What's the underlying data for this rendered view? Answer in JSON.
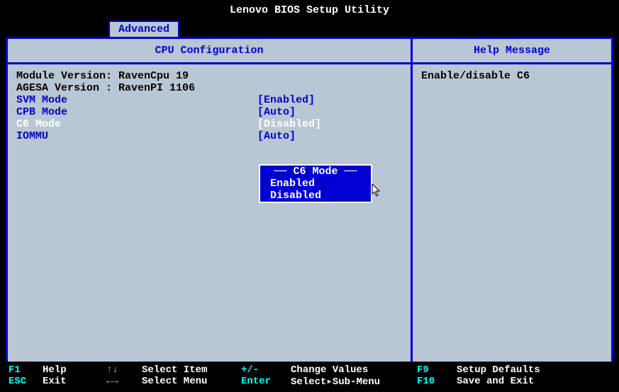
{
  "title": "Lenovo BIOS Setup Utility",
  "tab": "Advanced",
  "left": {
    "title": "CPU Configuration",
    "info1": "Module Version: RavenCpu 19",
    "info2": "AGESA Version : RavenPI 1106",
    "options": {
      "svm": {
        "label": "SVM Mode",
        "value": "[Enabled]"
      },
      "cpb": {
        "label": "CPB Mode",
        "value": "[Auto]"
      },
      "c6": {
        "label": "C6 Mode",
        "value": "[Disabled]"
      },
      "iommu": {
        "label": "IOMMU",
        "value": "[Auto]"
      }
    }
  },
  "right": {
    "title": "Help Message",
    "text": "Enable/disable C6"
  },
  "popup": {
    "title": "C6 Mode",
    "opt1": "Enabled",
    "opt2": "Disabled"
  },
  "footer": {
    "r1": {
      "k1": "F1",
      "l1": "Help",
      "a1": "↑↓",
      "l2": "Select Item",
      "a2": "+/-",
      "l3": "Change Values",
      "k2": "F9",
      "l4": "Setup Defaults"
    },
    "r2": {
      "k1": "ESC",
      "l1": "Exit",
      "a1": "←→",
      "l2": "Select Menu",
      "a2": "Enter",
      "l3": "Select▸Sub-Menu",
      "k2": "F10",
      "l4": "Save and Exit"
    }
  }
}
